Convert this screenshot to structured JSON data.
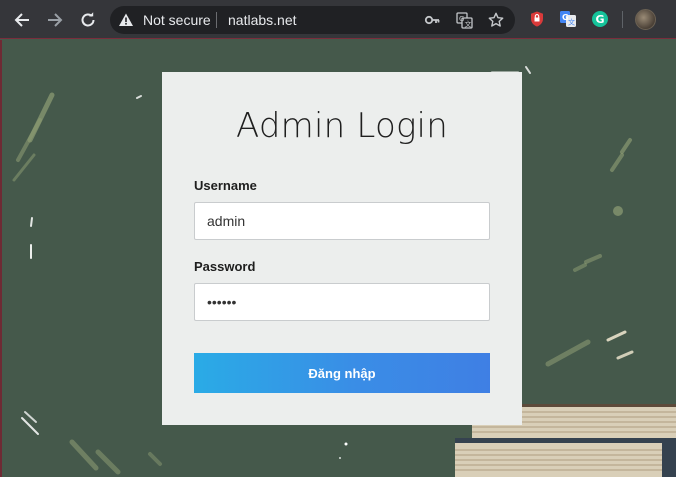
{
  "browser": {
    "security_label": "Not secure",
    "url": "natlabs.net",
    "icons": {
      "back": "back-arrow-icon",
      "forward": "forward-arrow-icon",
      "reload": "reload-icon",
      "warning": "warning-icon",
      "key": "key-icon",
      "translate": "translate-icon",
      "star": "star-icon",
      "shield": "shield-extension-icon",
      "google_translate": "google-translate-icon",
      "grammarly": "grammarly-icon",
      "profile": "profile-avatar"
    },
    "grammarly_letter": "G"
  },
  "login": {
    "title": "Admin Login",
    "username_label": "Username",
    "username_value": "admin",
    "password_label": "Password",
    "password_value": "••••••",
    "submit_label": "Đăng nhập"
  },
  "colors": {
    "board": "#45594b",
    "card": "#eceeed",
    "button_start": "#2aabe6",
    "button_end": "#3f7fe4",
    "toolbar": "#35363a",
    "omnibox": "#202124"
  }
}
